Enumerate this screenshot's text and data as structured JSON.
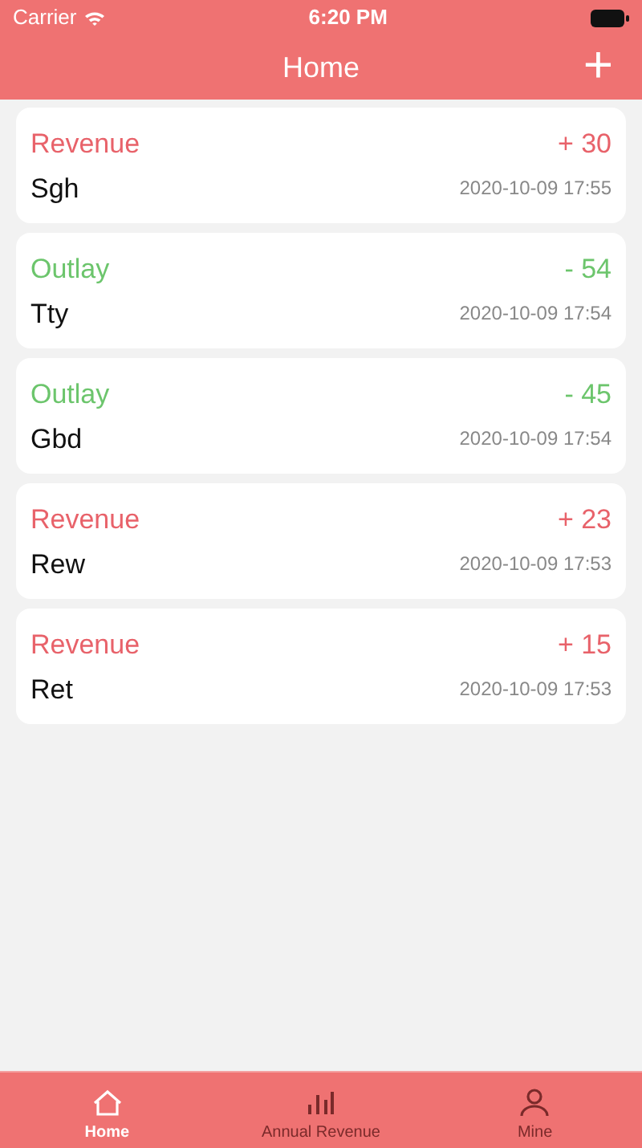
{
  "status_bar": {
    "carrier": "Carrier",
    "time": "6:20 PM"
  },
  "nav_bar": {
    "title": "Home",
    "action": "+"
  },
  "records": [
    {
      "kind": "revenue",
      "category": "Revenue",
      "amount": "+ 30",
      "name": "Sgh",
      "time": "2020-10-09 17:55"
    },
    {
      "kind": "outlay",
      "category": "Outlay",
      "amount": "- 54",
      "name": "Tty",
      "time": "2020-10-09 17:54"
    },
    {
      "kind": "outlay",
      "category": "Outlay",
      "amount": "- 45",
      "name": "Gbd",
      "time": "2020-10-09 17:54"
    },
    {
      "kind": "revenue",
      "category": "Revenue",
      "amount": "+ 23",
      "name": "Rew",
      "time": "2020-10-09 17:53"
    },
    {
      "kind": "revenue",
      "category": "Revenue",
      "amount": "+ 15",
      "name": "Ret",
      "time": "2020-10-09 17:53"
    }
  ],
  "tab_bar": [
    {
      "label": "Home",
      "kind": "home",
      "selected": true
    },
    {
      "label": "Annual Revenue",
      "kind": "chart",
      "selected": false
    },
    {
      "label": "Mine",
      "kind": "person",
      "selected": false
    }
  ]
}
